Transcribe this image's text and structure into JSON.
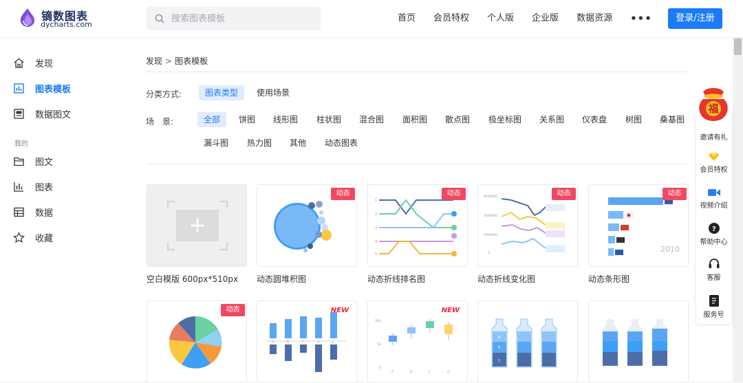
{
  "header": {
    "logo_cn": "镝数图表",
    "logo_en": "dycharts.com",
    "search_placeholder": "搜索图表模板",
    "nav": [
      "首页",
      "会员特权",
      "个人版",
      "企业版",
      "数据资源"
    ],
    "more": "•••",
    "login": "登录/注册"
  },
  "sidebar": {
    "items": [
      {
        "label": "发现",
        "icon": "home-icon"
      },
      {
        "label": "图表模板",
        "icon": "chart-template-icon",
        "active": true
      },
      {
        "label": "数据图文",
        "icon": "data-article-icon"
      }
    ],
    "group_label": "我的",
    "my_items": [
      {
        "label": "图文",
        "icon": "folder-icon"
      },
      {
        "label": "图表",
        "icon": "bar-chart-icon"
      },
      {
        "label": "数据",
        "icon": "table-icon"
      },
      {
        "label": "收藏",
        "icon": "star-icon"
      }
    ]
  },
  "breadcrumb": {
    "root": "发现",
    "sep": ">",
    "current": "图表模板"
  },
  "filters": {
    "category_label": "分类方式:",
    "categories": [
      "图表类型",
      "使用场景"
    ],
    "scene_label": "场　景:",
    "scenes_row1": [
      "全部",
      "饼图",
      "线形图",
      "柱状图",
      "混合图",
      "面积图",
      "散点图",
      "极坐标图",
      "关系图",
      "仪表盘",
      "树图",
      "桑基图"
    ],
    "scenes_row2": [
      "漏斗图",
      "热力图",
      "其他",
      "动态图表"
    ]
  },
  "cards": [
    {
      "title": "空白模版 600px*510px",
      "tag": ""
    },
    {
      "title": "动态圆堆积图",
      "tag": "动态"
    },
    {
      "title": "动态折线排名图",
      "tag": "动态"
    },
    {
      "title": "动态折线变化图",
      "tag": "动态"
    },
    {
      "title": "动态条形图",
      "tag": "动态"
    },
    {
      "title": "",
      "tag": "动态"
    },
    {
      "title": "",
      "tag": "NEW"
    },
    {
      "title": "",
      "tag": "NEW"
    },
    {
      "title": "",
      "tag": ""
    },
    {
      "title": "",
      "tag": ""
    }
  ],
  "thumb_text": {
    "year": "2010",
    "bar_letters": [
      "A",
      "B",
      "C",
      "D",
      "E"
    ],
    "bottle_labels": [
      "A",
      "B",
      "C"
    ],
    "line_axis": [
      "6000000",
      "4000000",
      "2000000",
      "0"
    ],
    "scatter_axis": [
      "100",
      "50",
      "0"
    ],
    "scatter_x": [
      "A",
      "B",
      "C",
      "D"
    ]
  },
  "float_panel": {
    "badge": "福",
    "items": [
      "邀请有礼",
      "会员特权",
      "视频介绍",
      "帮助中心",
      "客服",
      "服务号"
    ]
  }
}
